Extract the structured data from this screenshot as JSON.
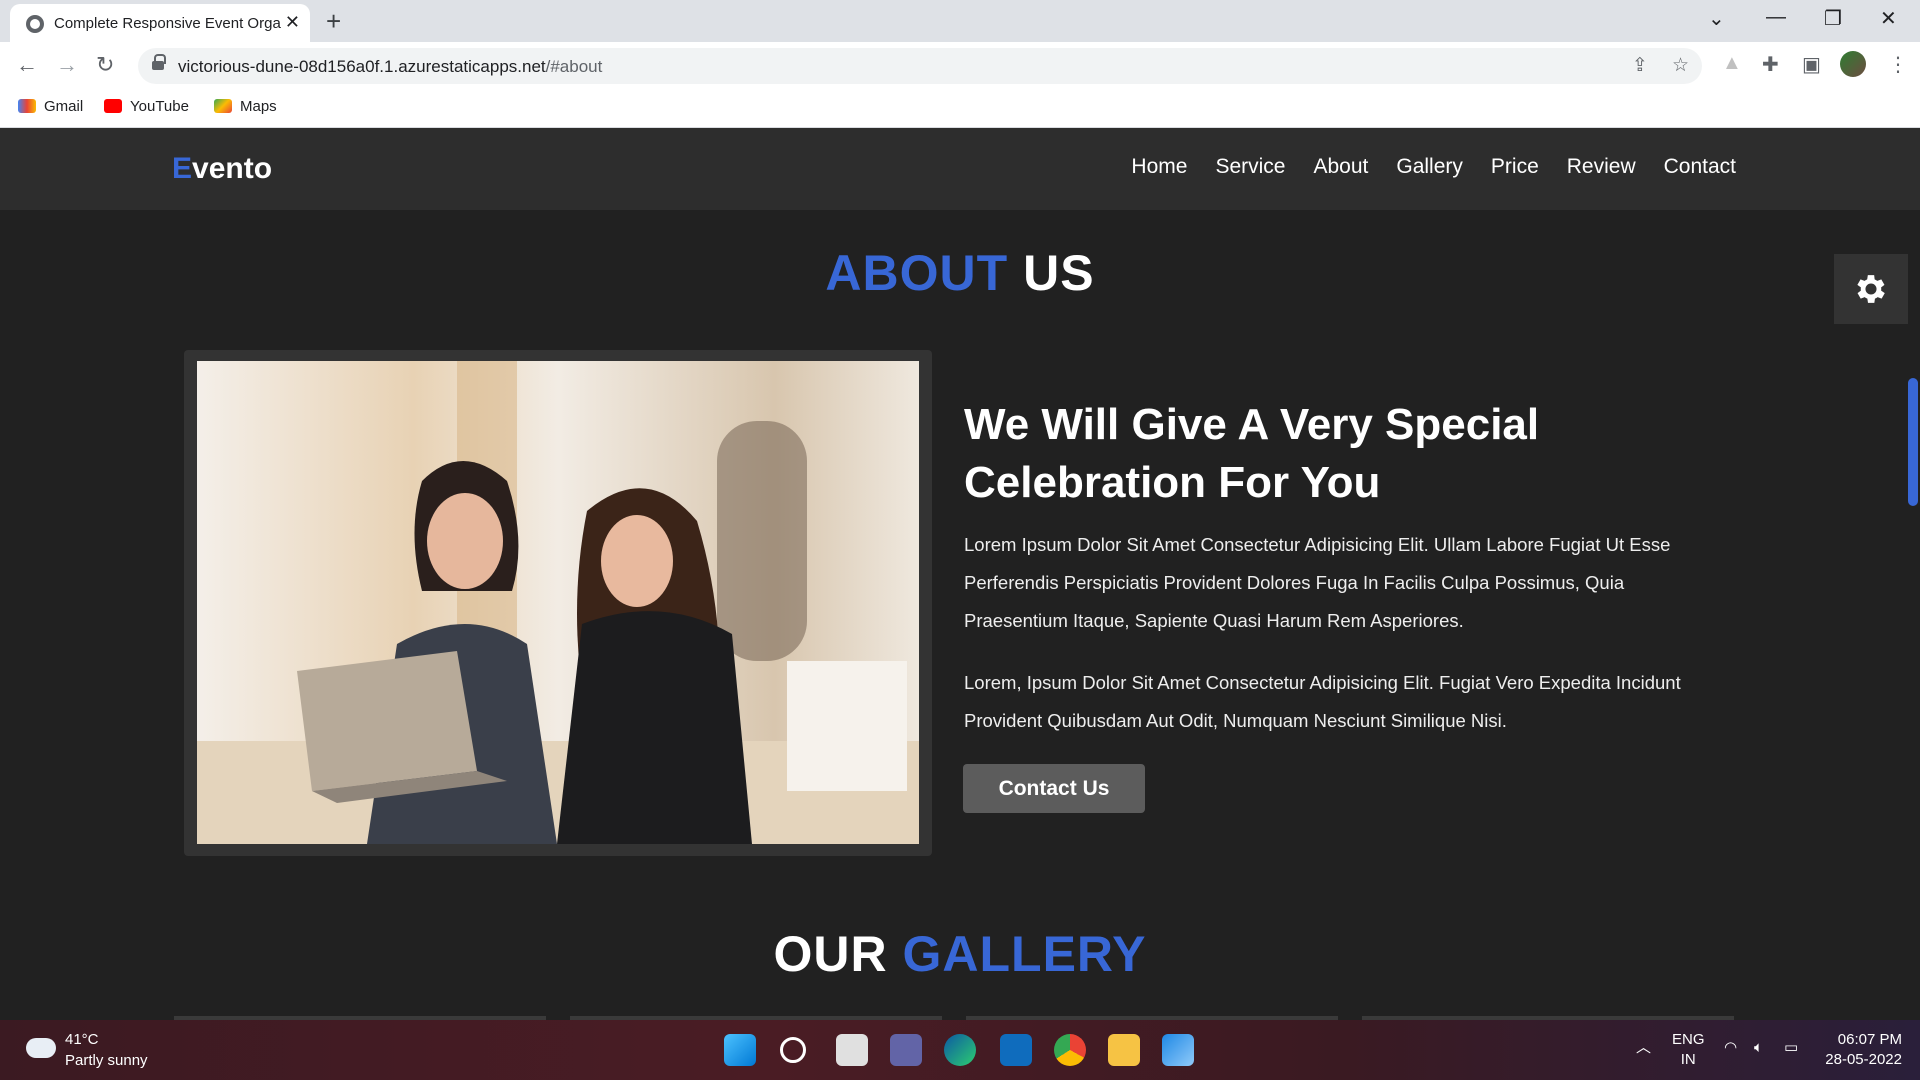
{
  "browser": {
    "tab_title": "Complete Responsive Event Orga",
    "url_host": "victorious-dune-08d156a0f.1.azurestaticapps.net",
    "url_path": "/#about",
    "bookmarks": [
      "Gmail",
      "YouTube",
      "Maps"
    ]
  },
  "site": {
    "logo_first": "E",
    "logo_rest": "vento",
    "nav": [
      "Home",
      "Service",
      "About",
      "Gallery",
      "Price",
      "Review",
      "Contact"
    ]
  },
  "about": {
    "heading_blue": "ABOUT",
    "heading_white": "US",
    "title": "We Will Give A Very Special Celebration For You",
    "para1": "Lorem Ipsum Dolor Sit Amet Consectetur Adipisicing Elit. Ullam Labore Fugiat Ut Esse Perferendis Perspiciatis Provident Dolores Fuga In Facilis Culpa Possimus, Quia Praesentium Itaque, Sapiente Quasi Harum Rem Asperiores.",
    "para2": "Lorem, Ipsum Dolor Sit Amet Consectetur Adipisicing Elit. Fugiat Vero Expedita Incidunt Provident Quibusdam Aut Odit, Numquam Nesciunt Similique Nisi.",
    "button": "Contact Us"
  },
  "gallery": {
    "heading_white": "OUR",
    "heading_blue": "GALLERY"
  },
  "taskbar": {
    "temperature": "41°C",
    "condition": "Partly sunny",
    "lang1": "ENG",
    "lang2": "IN",
    "time": "06:07 PM",
    "date": "28-05-2022"
  },
  "colors": {
    "accent": "#3867d6",
    "page_bg": "#212121",
    "header_bg": "#2d2d2d"
  }
}
